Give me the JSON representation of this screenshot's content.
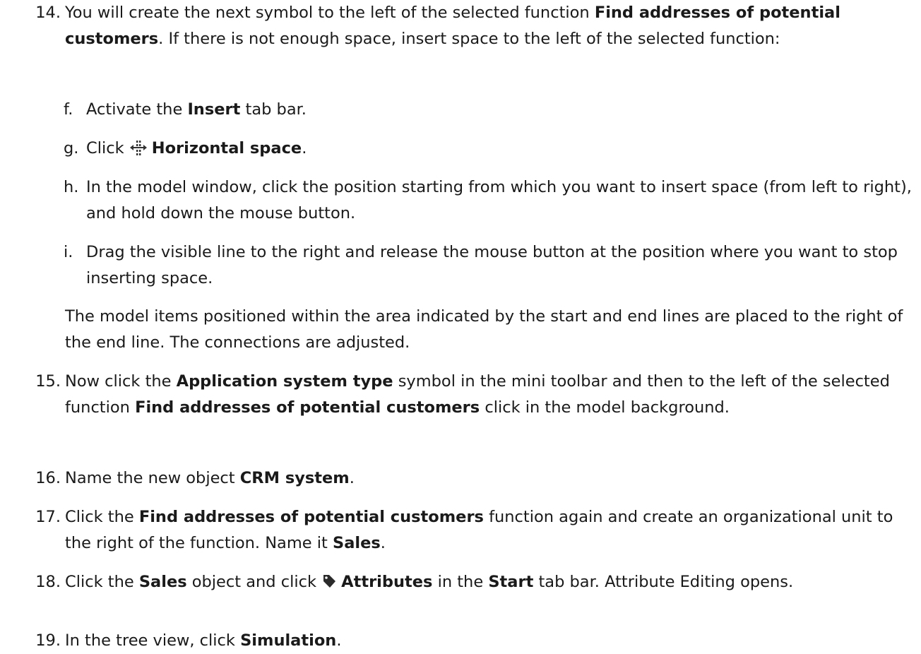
{
  "steps": [
    {
      "number": "14.",
      "parts": [
        {
          "t": "You will create the next symbol to the left of the selected function "
        },
        {
          "t": "Find addresses of potential customers",
          "b": true
        },
        {
          "t": ". If there is not enough space, insert space to the left of the selected function:"
        }
      ]
    }
  ],
  "substeps": [
    {
      "letter": "f.",
      "parts": [
        {
          "t": "Activate the "
        },
        {
          "t": "Insert",
          "b": true
        },
        {
          "t": " tab bar."
        }
      ]
    },
    {
      "letter": "g.",
      "icon": "horizontal-space-icon",
      "parts": [
        {
          "t": "Click "
        },
        {
          "t": "Horizontal space",
          "b": true
        },
        {
          "t": "."
        }
      ]
    },
    {
      "letter": "h.",
      "parts": [
        {
          "t": "In the model window, click the position starting from which you want to insert space (from left to right), and hold down the mouse button."
        }
      ]
    },
    {
      "letter": "i.",
      "parts": [
        {
          "t": "Drag the visible line to the right and release the mouse button at the position where you want to stop inserting space."
        }
      ]
    }
  ],
  "result_paragraph": "The model items positioned within the area indicated by the start and end lines are placed to the right of the end line. The connections are adjusted.",
  "later_steps": [
    {
      "number": "15.",
      "parts": [
        {
          "t": "Now click the "
        },
        {
          "t": "Application system type",
          "b": true
        },
        {
          "t": " symbol in the mini toolbar and then to the left of the selected function "
        },
        {
          "t": "Find addresses of potential customers",
          "b": true
        },
        {
          "t": " click in the model background."
        }
      ]
    },
    {
      "number": "16.",
      "parts": [
        {
          "t": "Name the new object "
        },
        {
          "t": "CRM system",
          "b": true
        },
        {
          "t": "."
        }
      ]
    },
    {
      "number": "17.",
      "parts": [
        {
          "t": "Click the "
        },
        {
          "t": "Find addresses of potential customers",
          "b": true
        },
        {
          "t": " function again and create an organizational unit to the right of the function. Name it "
        },
        {
          "t": "Sales",
          "b": true
        },
        {
          "t": "."
        }
      ]
    },
    {
      "number": "18.",
      "icon": "tag-icon",
      "parts": [
        {
          "t": "Click the "
        },
        {
          "t": "Sales",
          "b": true
        },
        {
          "t": " object and click "
        },
        {
          "icon": "tag-icon"
        },
        {
          "t": "Attributes",
          "b": true
        },
        {
          "t": " in the "
        },
        {
          "t": "Start",
          "b": true
        },
        {
          "t": " tab bar. Attribute Editing opens."
        }
      ]
    },
    {
      "number": "19.",
      "parts": [
        {
          "t": "In the tree view, click "
        },
        {
          "t": "Simulation",
          "b": true
        },
        {
          "t": "."
        }
      ]
    }
  ]
}
